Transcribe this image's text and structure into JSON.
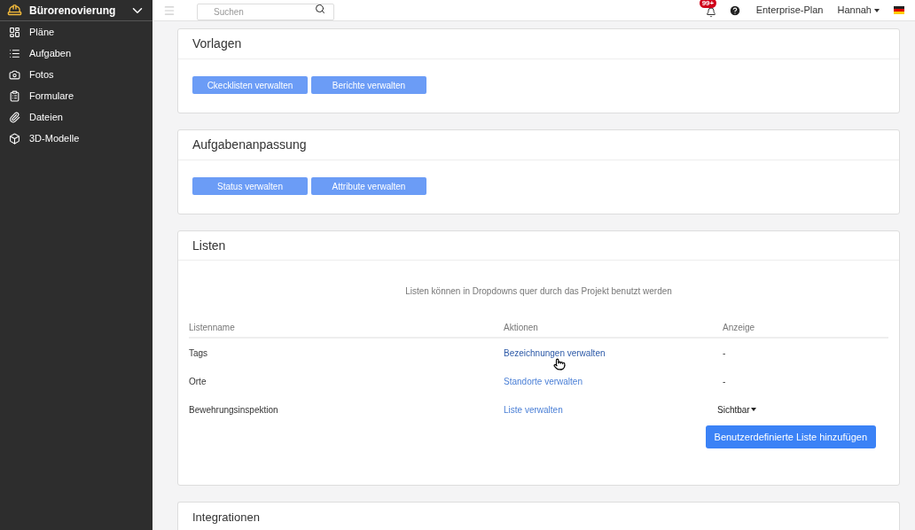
{
  "project": {
    "name": "Bürorenovierung"
  },
  "sidebar": {
    "items": [
      {
        "label": "Pläne"
      },
      {
        "label": "Aufgaben"
      },
      {
        "label": "Fotos"
      },
      {
        "label": "Formulare"
      },
      {
        "label": "Dateien"
      },
      {
        "label": "3D-Modelle"
      }
    ]
  },
  "topbar": {
    "search": {
      "placeholder": "Suchen"
    },
    "notifications": "99+",
    "plan": "Enterprise-Plan",
    "user": "Hannah"
  },
  "sections": [
    {
      "title": "Vorlagen",
      "buttons": [
        "Ckecklisten verwalten",
        "Berichte verwalten"
      ]
    },
    {
      "title": "Aufgabenanpassung",
      "buttons": [
        "Status verwalten",
        "Attribute verwalten"
      ]
    }
  ],
  "lists": {
    "title": "Listen",
    "description": "Listen können in Dropdowns quer durch das Projekt benutzt werden",
    "columns": [
      "Listenname",
      "Aktionen",
      "Anzeige"
    ],
    "rows": [
      {
        "name": "Tags",
        "action": "Bezeichnungen verwalten",
        "hovered": true,
        "display": "-",
        "kind": "text"
      },
      {
        "name": "Orte",
        "action": "Standorte verwalten",
        "hovered": false,
        "display": "-",
        "kind": "text"
      },
      {
        "name": "Bewehrungsinspektion",
        "action": "Liste verwalten",
        "hovered": false,
        "display": "Sichtbar",
        "kind": "dropdown"
      }
    ],
    "add_button": "Benutzerdefinierte Liste hinzufügen"
  },
  "next_section": {
    "title": "Integrationen"
  }
}
